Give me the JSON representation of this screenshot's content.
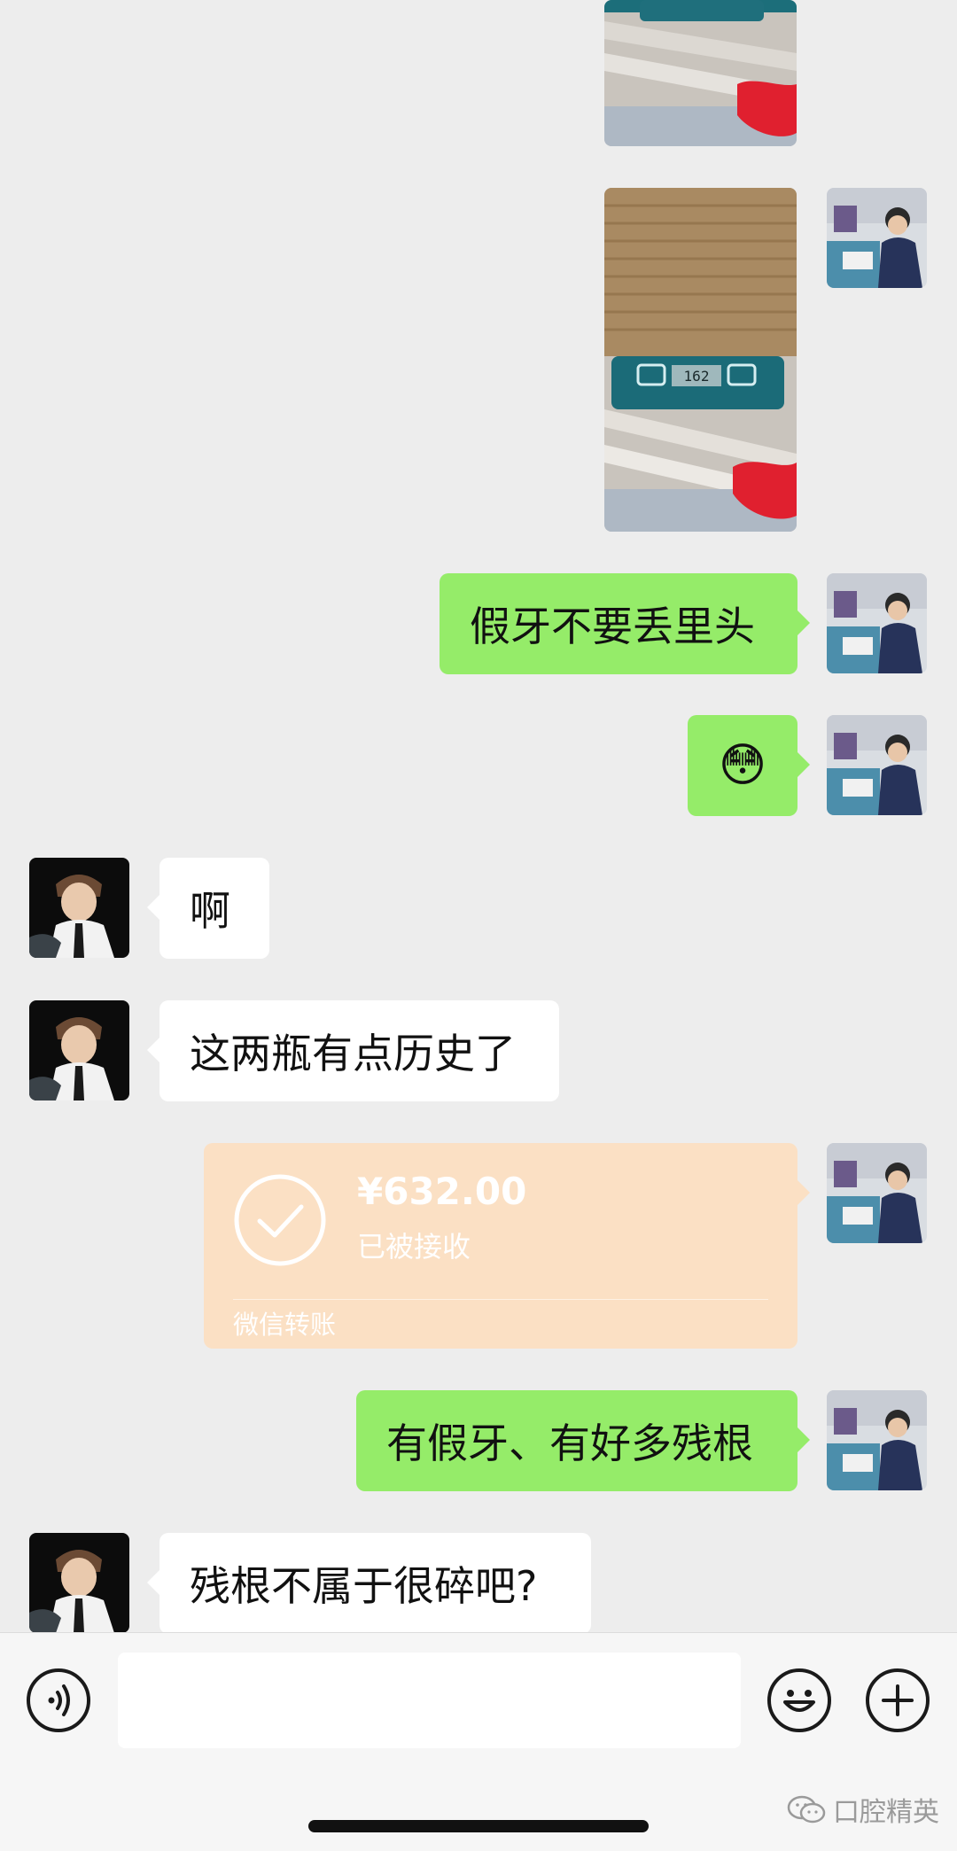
{
  "messages": {
    "fake_teeth": "假牙不要丢里头",
    "emoji": "😳",
    "ah": "啊",
    "history": "这两瓶有点历史了",
    "roots": "有假牙、有好多残根",
    "question": "残根不属于很碎吧?"
  },
  "transfer": {
    "amount": "¥632.00",
    "status": "已被接收",
    "footer": "微信转账"
  },
  "scale_display": "162",
  "watermark": "口腔精英",
  "icons": {
    "voice": "voice-icon",
    "emoji": "emoji-icon",
    "add": "plus-icon"
  },
  "colors": {
    "chat_bg": "#ededed",
    "outgoing_bubble": "#95ec69",
    "incoming_bubble": "#ffffff",
    "transfer_card": "#fbe0c4"
  }
}
